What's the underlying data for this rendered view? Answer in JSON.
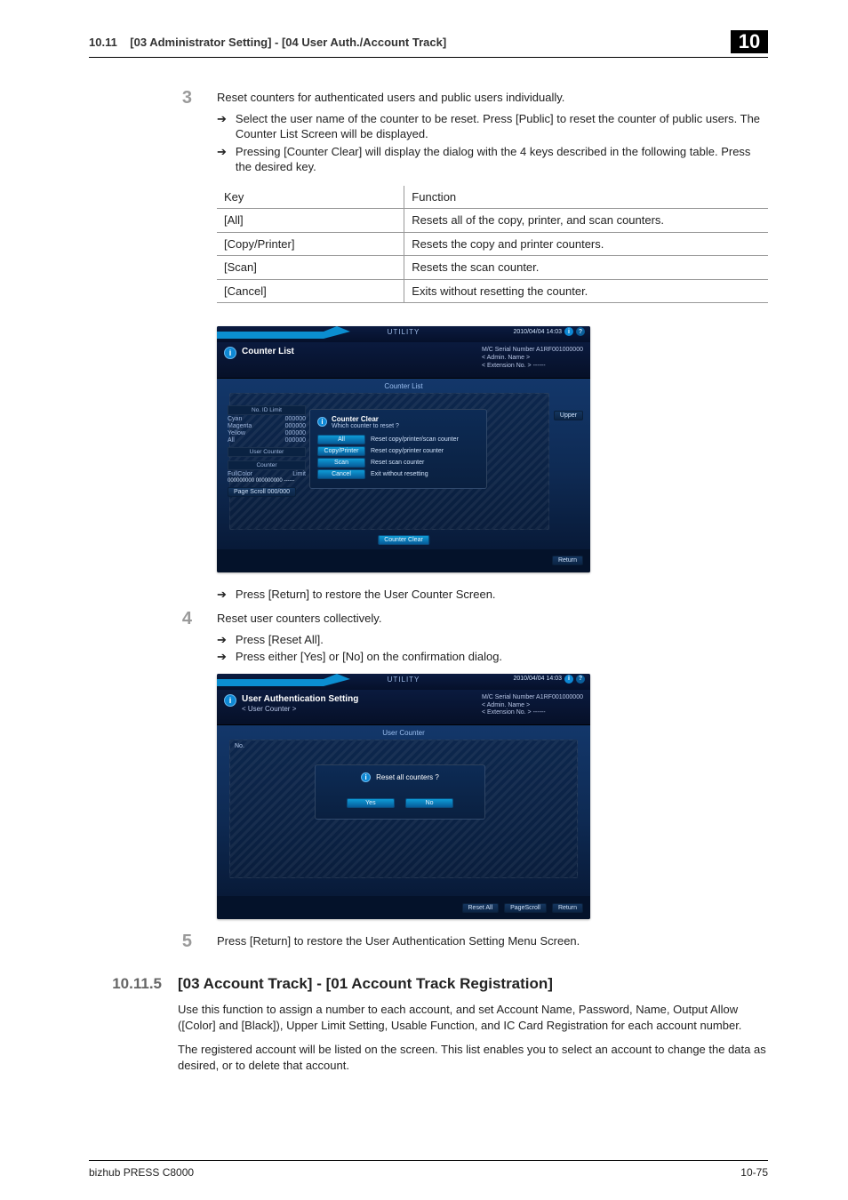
{
  "running_head": {
    "section_no": "10.11",
    "section_title": "[03 Administrator Setting] - [04 User Auth./Account Track]",
    "chapter_box": "10"
  },
  "step3": {
    "num": "3",
    "text": "Reset counters for authenticated users and public users individually.",
    "bullets": [
      "Select the user name of the counter to be reset. Press [Public] to reset the counter of public users. The Counter List Screen will be displayed.",
      "Pressing [Counter Clear] will display the dialog with the 4 keys described in the following table. Press the desired key."
    ]
  },
  "table": {
    "headers": {
      "key": "Key",
      "fn": "Function"
    },
    "rows": [
      {
        "key": "[All]",
        "fn": "Resets all of the copy, printer, and scan counters."
      },
      {
        "key": "[Copy/Printer]",
        "fn": "Resets the copy and printer counters."
      },
      {
        "key": "[Scan]",
        "fn": "Resets the scan counter."
      },
      {
        "key": "[Cancel]",
        "fn": "Exits without resetting the counter."
      }
    ]
  },
  "shot_meta": {
    "utility": "UTILITY",
    "datetime": "2010/04/04 14:03",
    "serial_label": "M/C Serial Number",
    "serial_value": " A1RF001000000",
    "admin_line": "< Admin. Name >",
    "ext_line": "< Extension No. > ------"
  },
  "shot1": {
    "title": "Counter List",
    "center": "Counter List",
    "dlg_title": "Counter Clear",
    "dlg_sub": "Which counter to reset ?",
    "opts": [
      {
        "btn": "All",
        "lbl": "Reset copy/printer/scan counter"
      },
      {
        "btn": "Copy/Printer",
        "lbl": "Reset copy/printer counter"
      },
      {
        "btn": "Scan",
        "lbl": "Reset scan counter"
      },
      {
        "btn": "Cancel",
        "lbl": "Exit without resetting"
      }
    ],
    "left_hdr": "No.  ID  Limit",
    "left_rows": [
      {
        "a": "Cyan",
        "b": "000000"
      },
      {
        "a": "Magenta",
        "b": "000000"
      },
      {
        "a": "Yellow",
        "b": "000000"
      },
      {
        "a": "All",
        "b": "000000"
      }
    ],
    "left_cap": "User Counter",
    "left_count": "Counter",
    "left_total1": "FullColor",
    "left_total2": "Limit",
    "left_total3": "000000000  000000000  ------",
    "page_btn": "Page Scroll  000/000",
    "foot_center": "Counter Clear",
    "foot_return": "Return",
    "upper": "Upper"
  },
  "after_shot1": "Press [Return] to restore the User Counter Screen.",
  "step4": {
    "num": "4",
    "text": "Reset user counters collectively.",
    "bullets": [
      "Press [Reset All].",
      "Press either [Yes] or [No] on the confirmation dialog."
    ]
  },
  "shot2": {
    "title": "User Authentication Setting",
    "subtitle": "< User Counter >",
    "center": "User Counter",
    "no_lbl": "No.",
    "question": "Reset all counters ?",
    "yes": "Yes",
    "no": "No",
    "foot1": "Reset All",
    "foot2": "PageScroll",
    "foot3": "Return"
  },
  "step5": {
    "num": "5",
    "text": "Press [Return] to restore the User Authentication Setting Menu Screen."
  },
  "section": {
    "num": "10.11.5",
    "title": "[03 Account Track] - [01 Account Track Registration]"
  },
  "paras": [
    "Use this function to assign a number to each account, and set Account Name, Password, Name, Output Allow ([Color] and [Black]), Upper Limit Setting, Usable Function, and IC Card Registration for each account number.",
    "The registered account will be listed on the screen. This list enables you to select an account to change the data as desired, or to delete that account."
  ],
  "footer": {
    "product": "bizhub PRESS C8000",
    "page": "10-75"
  }
}
